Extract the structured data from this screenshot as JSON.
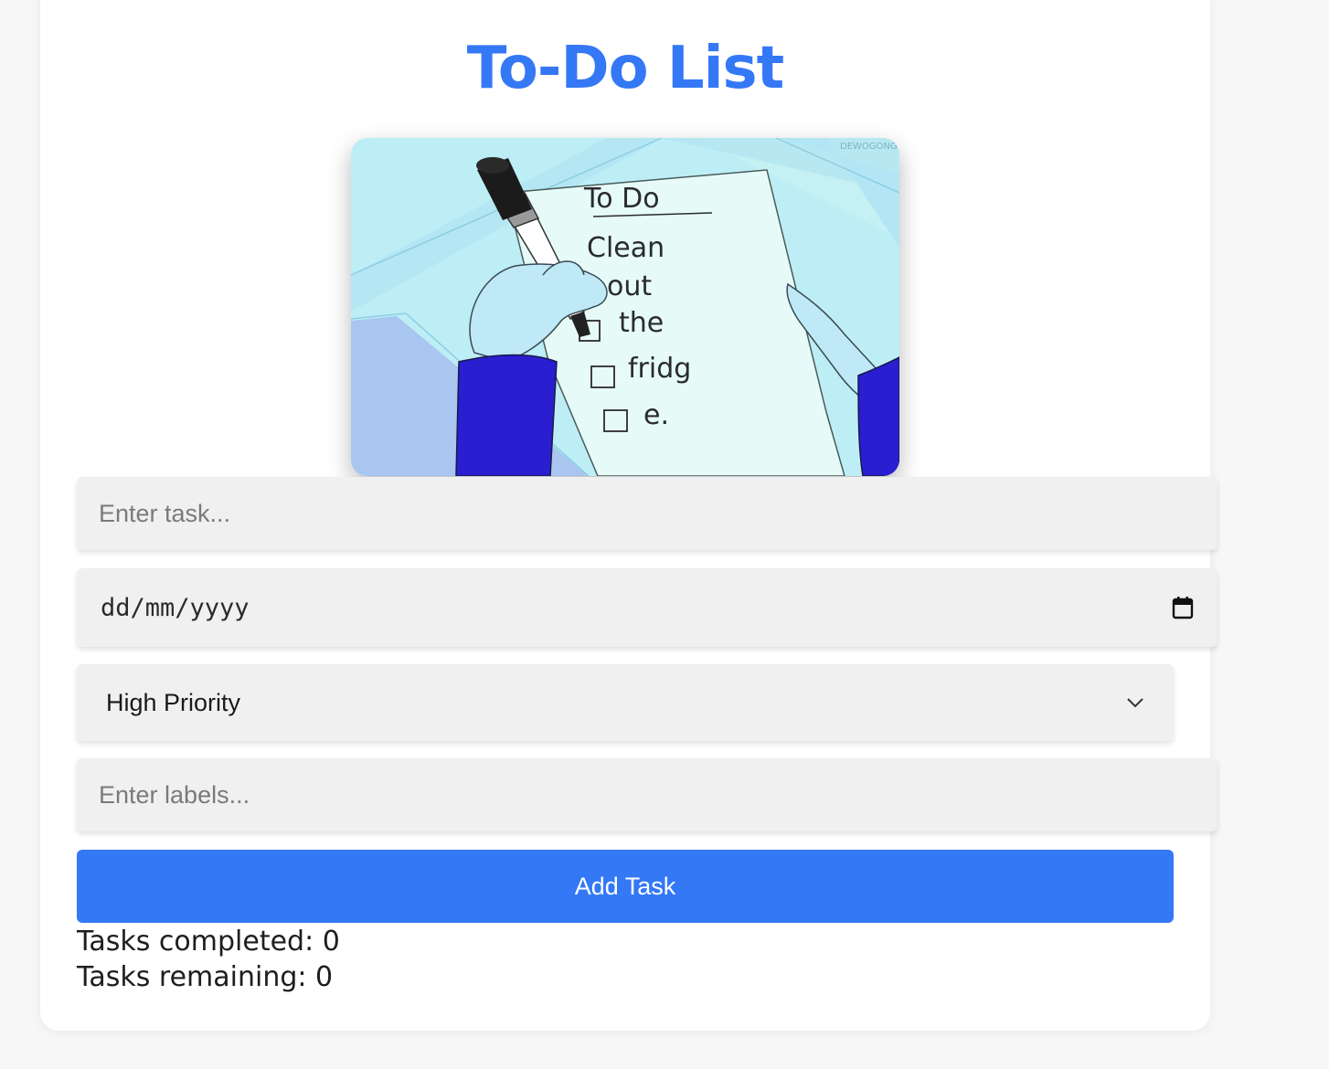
{
  "header": {
    "title": "To-Do List"
  },
  "illustration": {
    "watermark": "DEWOGONG",
    "heading": "To Do",
    "items": [
      "Clean",
      "out",
      "the",
      "fridg",
      "e."
    ]
  },
  "form": {
    "task_placeholder": "Enter task...",
    "date_placeholder": "dd/mm/yyyy",
    "priority_selected": "High Priority",
    "labels_placeholder": "Enter labels...",
    "add_button_label": "Add Task"
  },
  "stats": {
    "completed_label": "Tasks completed: ",
    "completed_count": "0",
    "remaining_label": "Tasks remaining: ",
    "remaining_count": "0"
  },
  "colors": {
    "accent": "#3478f6",
    "field_background": "#f0f0f0",
    "page_background": "#f7f7f7"
  },
  "icons": {
    "date_picker": "calendar-icon",
    "select": "chevron-down-icon"
  }
}
